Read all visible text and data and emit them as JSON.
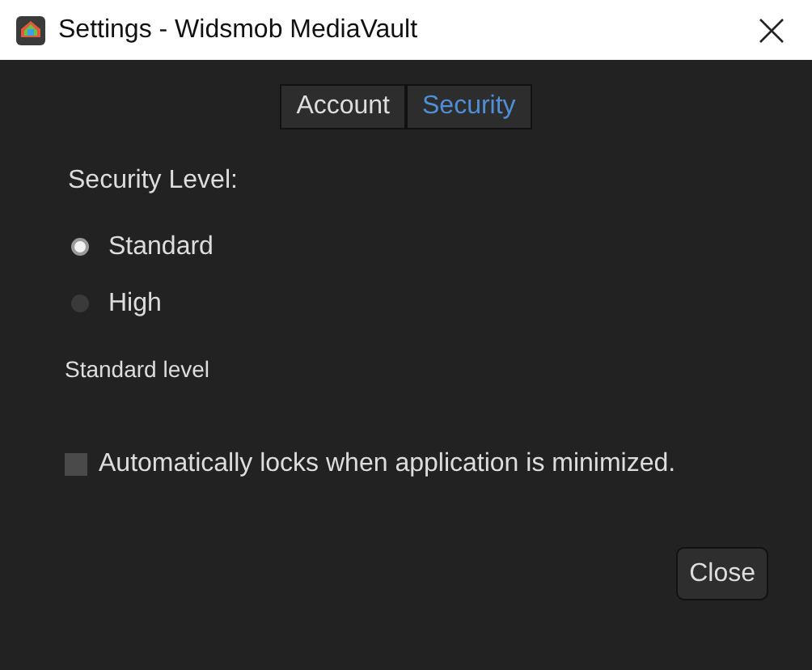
{
  "window": {
    "title": "Settings - Widsmob MediaVault"
  },
  "tabs": [
    {
      "label": "Account",
      "selected": false
    },
    {
      "label": "Security",
      "selected": true
    }
  ],
  "security_level": {
    "label": "Security Level:",
    "options": [
      {
        "label": "Standard",
        "selected": true
      },
      {
        "label": "High",
        "selected": false
      }
    ],
    "description": "Standard level"
  },
  "auto_lock": {
    "label": "Automatically locks when application is minimized.",
    "checked": false
  },
  "buttons": [
    "Close"
  ]
}
